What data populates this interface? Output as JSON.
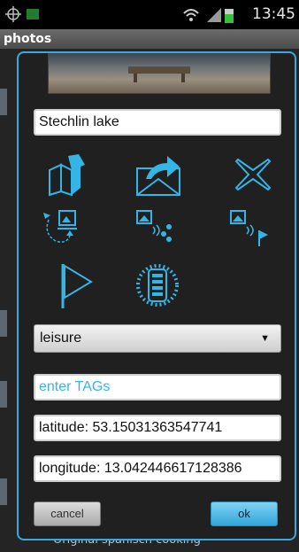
{
  "status_bar": {
    "time": "13:45"
  },
  "app_bar": {
    "title": "photos"
  },
  "background": {
    "partial_text": "Original spanisch cooking"
  },
  "dialog": {
    "title_value": "Stechlin lake",
    "category_selected": "leisure",
    "tags_placeholder": "enter TAGs",
    "latitude": "latitude: 53.15031363547741",
    "longitude": "longitude: 13.042446617128386",
    "cancel_label": "cancel",
    "ok_label": "ok",
    "icons": [
      "map-icon",
      "share-mail-icon",
      "delete-icon",
      "rotate-photo-icon",
      "nfc-send-icon",
      "nfc-flag-icon",
      "flag-icon",
      "battery-icon"
    ],
    "accent_color": "#36a9e1"
  }
}
